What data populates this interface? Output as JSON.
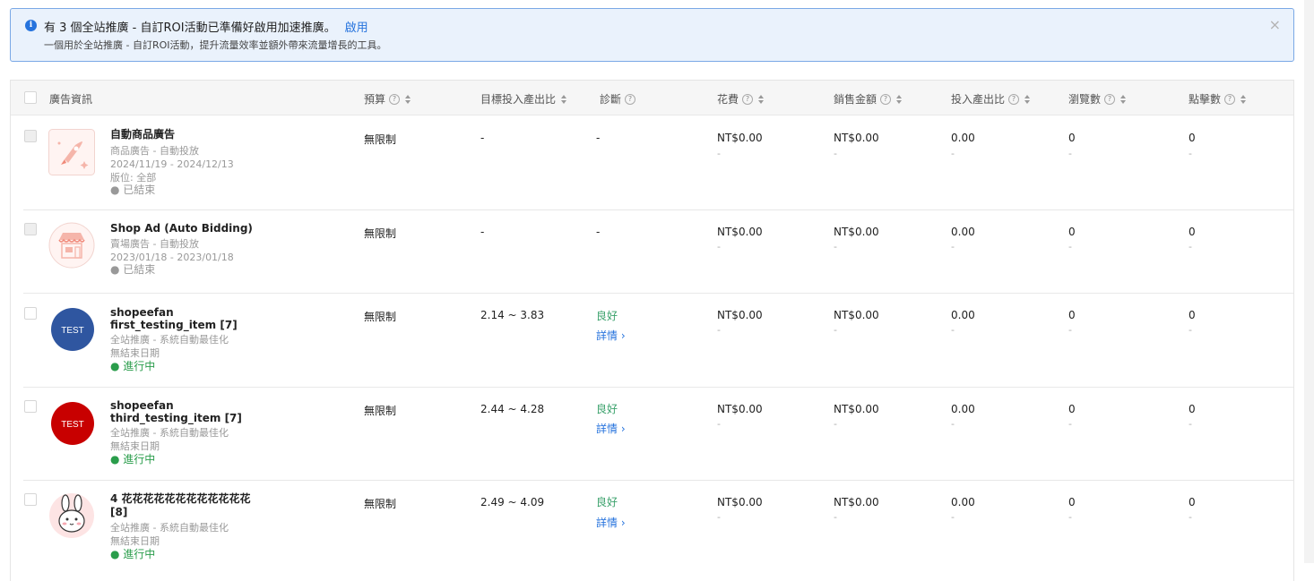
{
  "banner": {
    "title": "有 3 個全站推廣 - 自訂ROI活動已準備好啟用加速推廣。",
    "enable_label": "啟用",
    "subtitle": "一個用於全站推廣 - 自訂ROI活動，提升流量效率並額外帶來流量增長的工具。",
    "info_icon": "i",
    "close_icon": "×"
  },
  "table": {
    "headers": {
      "ad_info": "廣告資訊",
      "budget": "預算",
      "target_roas": "目標投入產出比",
      "diagnosis": "診斷",
      "spend": "花費",
      "sales": "銷售金額",
      "roas": "投入產出比",
      "views": "瀏覽數",
      "clicks": "點擊數"
    },
    "help_icon": "?",
    "rows": [
      {
        "name_line1": "自動商品廣告",
        "name_line2": "",
        "type": "商品廣告 - 自動投放",
        "date": "2024/11/19 - 2024/12/13",
        "placement": "版位: 全部",
        "status": "● 已結束",
        "budget": "無限制",
        "target_roas": "-",
        "diagnosis": "-",
        "detail": "",
        "spend": "NT$0.00",
        "sales": "NT$0.00",
        "roas": "0.00",
        "views": "0",
        "clicks": "0",
        "sub": "-"
      },
      {
        "name_line1": "Shop Ad (Auto Bidding)",
        "name_line2": "",
        "type": "賣場廣告 - 自動投放",
        "date": "2023/01/18 - 2023/01/18",
        "placement": "",
        "status": "● 已結束",
        "budget": "無限制",
        "target_roas": "-",
        "diagnosis": "-",
        "detail": "",
        "spend": "NT$0.00",
        "sales": "NT$0.00",
        "roas": "0.00",
        "views": "0",
        "clicks": "0",
        "sub": "-"
      },
      {
        "name_line1": "shopeefan",
        "name_line2": "first_testing_item [7]",
        "type": "全站推廣 - 系統自動最佳化",
        "date": "無結束日期",
        "placement": "",
        "status": "● 進行中",
        "thumb_text": "TEST",
        "budget": "無限制",
        "target_roas": "2.14 ~ 3.83",
        "diagnosis": "良好",
        "detail": "詳情 ›",
        "spend": "NT$0.00",
        "sales": "NT$0.00",
        "roas": "0.00",
        "views": "0",
        "clicks": "0",
        "sub": "-"
      },
      {
        "name_line1": "shopeefan",
        "name_line2": "third_testing_item [7]",
        "type": "全站推廣 - 系統自動最佳化",
        "date": "無結束日期",
        "placement": "",
        "status": "● 進行中",
        "thumb_text": "TEST",
        "budget": "無限制",
        "target_roas": "2.44 ~ 4.28",
        "diagnosis": "良好",
        "detail": "詳情 ›",
        "spend": "NT$0.00",
        "sales": "NT$0.00",
        "roas": "0.00",
        "views": "0",
        "clicks": "0",
        "sub": "-"
      },
      {
        "name_line1": "4 花花花花花花花花花花花花",
        "name_line2": "[8]",
        "type": "全站推廣 - 系統自動最佳化",
        "date": "無結束日期",
        "placement": "",
        "status": "● 進行中",
        "budget": "無限制",
        "target_roas": "2.49 ~ 4.09",
        "diagnosis": "良好",
        "detail": "詳情 ›",
        "spend": "NT$0.00",
        "sales": "NT$0.00",
        "roas": "0.00",
        "views": "0",
        "clicks": "0",
        "sub": "-"
      }
    ]
  },
  "colors": {
    "accent": "#2673dd",
    "good": "#3aa16b",
    "running": "#2a9d4b",
    "thumb_blue": "#2f56a0",
    "thumb_red": "#c80000"
  }
}
